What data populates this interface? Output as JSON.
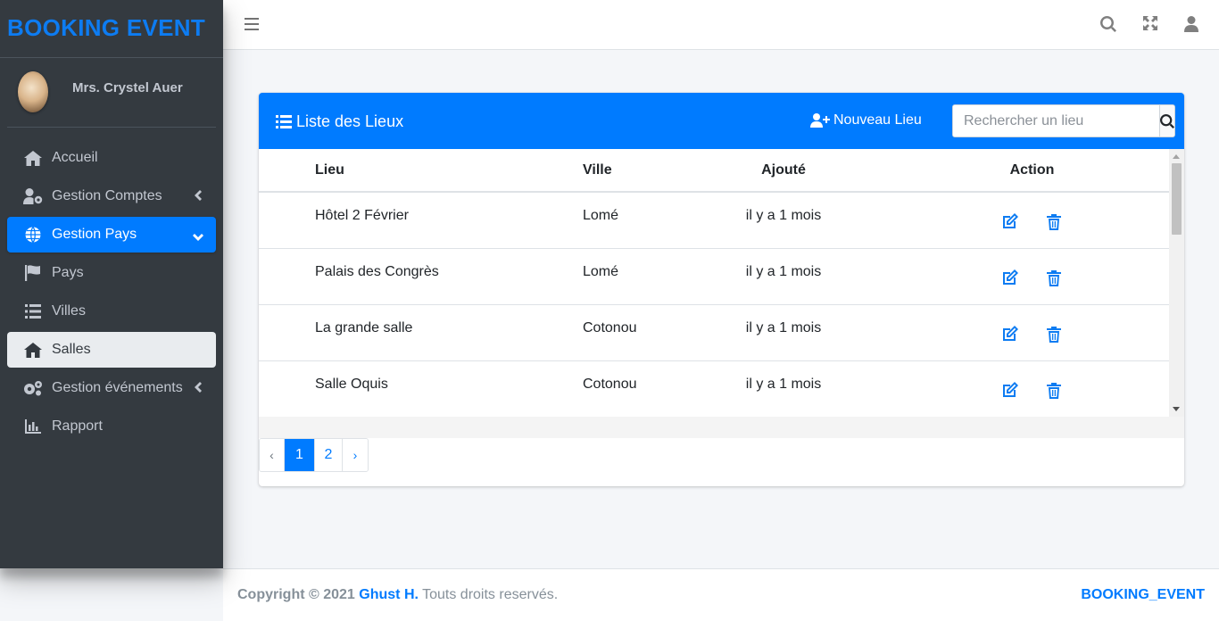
{
  "brand": "BOOKING EVENT",
  "user": {
    "name": "Mrs. Crystel Auer"
  },
  "sidebar": {
    "items": [
      {
        "label": "Accueil",
        "icon": "home-icon"
      },
      {
        "label": "Gestion Comptes",
        "icon": "user-cog-icon",
        "chevron": "left"
      },
      {
        "label": "Gestion Pays",
        "icon": "globe-icon",
        "chevron": "down",
        "state": "active"
      },
      {
        "label": "Pays",
        "icon": "flag-icon"
      },
      {
        "label": "Villes",
        "icon": "list-icon"
      },
      {
        "label": "Salles",
        "icon": "home-icon",
        "state": "selected"
      },
      {
        "label": "Gestion événements",
        "icon": "cogs-icon",
        "chevron": "left"
      },
      {
        "label": "Rapport",
        "icon": "chart-bar-icon"
      }
    ]
  },
  "card": {
    "title": "Liste des Lieux",
    "new_button": "Nouveau Lieu",
    "search_placeholder": "Rechercher un lieu"
  },
  "table": {
    "headers": {
      "lieu": "Lieu",
      "ville": "Ville",
      "ajoute": "Ajouté",
      "action": "Action"
    },
    "rows": [
      {
        "lieu": "Hôtel 2 Février",
        "ville": "Lomé",
        "ajoute": "il y a 1 mois"
      },
      {
        "lieu": "Palais des Congrès",
        "ville": "Lomé",
        "ajoute": "il y a 1 mois"
      },
      {
        "lieu": "La grande salle",
        "ville": "Cotonou",
        "ajoute": "il y a 1 mois"
      },
      {
        "lieu": "Salle Oquis",
        "ville": "Cotonou",
        "ajoute": "il y a 1 mois"
      }
    ]
  },
  "pagination": {
    "prev": "‹",
    "pages": [
      "1",
      "2"
    ],
    "current": "1",
    "next": "›"
  },
  "footer": {
    "copyright": "Copyright © 2021",
    "author": "Ghust H.",
    "rights": "Touts droits reservés.",
    "brand": "BOOKING_EVENT"
  },
  "colors": {
    "primary": "#007bff",
    "sidebar": "#343a40",
    "background": "#f4f6f9"
  }
}
